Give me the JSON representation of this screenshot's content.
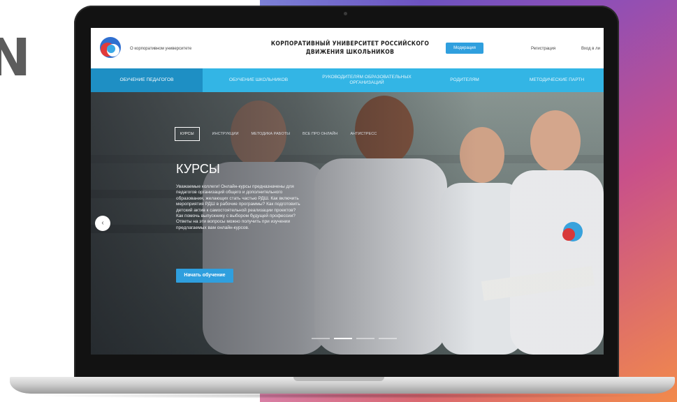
{
  "background": {
    "letter": "N",
    "gradient_colors": [
      "#4f56c8",
      "#8c4fb8",
      "#c8508a",
      "#f28a4b"
    ]
  },
  "header": {
    "about_link": "О корпоративном университете",
    "site_title": "КОРПОРАТИВНЫЙ УНИВЕРСИТЕТ РОССИЙСКОГО ДВИЖЕНИЯ ШКОЛЬНИКОВ",
    "moderate_button": "Модерация",
    "register_link": "Регистрация",
    "login_link": "Вход в ли"
  },
  "nav": {
    "items": [
      {
        "label": "ОБУЧЕНИЕ ПЕДАГОГОВ",
        "active": true
      },
      {
        "label": "ОБУЧЕНИЕ ШКОЛЬНИКОВ",
        "active": false
      },
      {
        "label": "РУКОВОДИТЕЛЯМ ОБРАЗОВАТЕЛЬНЫХ ОРГАНИЗАЦИЙ",
        "active": false
      },
      {
        "label": "РОДИТЕЛЯМ",
        "active": false
      },
      {
        "label": "МЕТОДИЧЕСКИЕ ПАРТН",
        "active": false
      }
    ]
  },
  "hero": {
    "tabs": [
      "КУРСЫ",
      "ИНСТРУКЦИИ",
      "МЕТОДИКА РАБОТЫ",
      "ВСЕ ПРО ОНЛАЙН",
      "АНТИСТРЕСС"
    ],
    "active_tab": "КУРСЫ",
    "heading": "КУРСЫ",
    "text": "Уважаемые коллеги! Онлайн-курсы предназначены для педагогов организаций общего и дополнительного образования, желающих стать частью РДШ. Как включить мероприятия РДШ в рабочие программы? Как подготовить детский актив к самостоятельной реализации проектов? Как помочь выпускнику с выбором будущей профессии? Ответы на эти вопросы можно получить при изучении предлагаемых вам онлайн-курсов.",
    "start_button": "Начать обучение",
    "prev_arrow": "‹",
    "slides": 4,
    "active_slide": 1
  },
  "colors": {
    "accent": "#2f9fde",
    "nav": "#33b5e5",
    "nav_active": "#1e8fc4"
  }
}
